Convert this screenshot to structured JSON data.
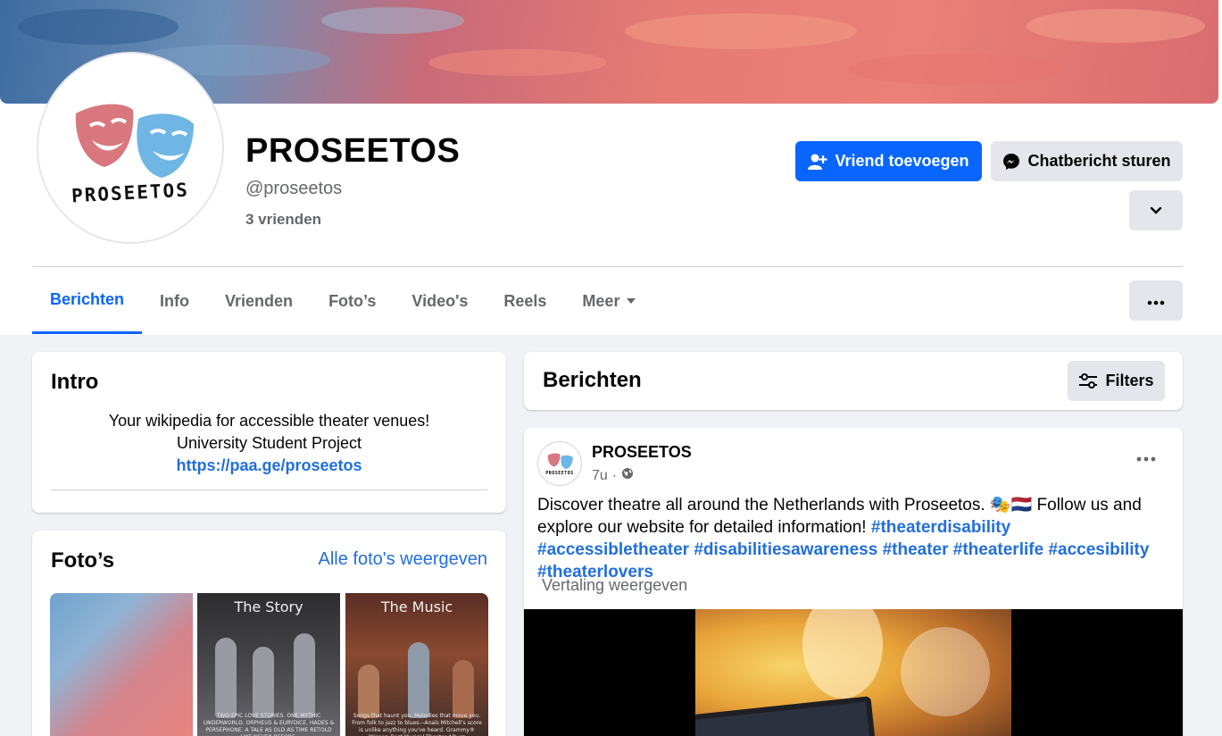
{
  "profile": {
    "name": "PROSEETOS",
    "handle": "@proseetos",
    "friends": "3 vrienden",
    "logo_word": "PROSEETOS"
  },
  "actions": {
    "add_friend": "Vriend toevoegen",
    "message": "Chatbericht sturen"
  },
  "icons": {
    "add_friend": "user-plus-icon",
    "message": "messenger-icon",
    "dropdown": "chevron-down-icon",
    "more": "more-dots-icon",
    "filters": "sliders-icon",
    "audience": "globe-icon"
  },
  "tabs": [
    {
      "label": "Berichten",
      "active": true
    },
    {
      "label": "Info"
    },
    {
      "label": "Vrienden"
    },
    {
      "label": "Foto’s"
    },
    {
      "label": "Video's"
    },
    {
      "label": "Reels"
    },
    {
      "label": "Meer"
    }
  ],
  "intro": {
    "title": "Intro",
    "bio_line1": "Your wikipedia for accessible theater venues!",
    "bio_line2": "University Student Project",
    "link": "https://paa.ge/proseetos"
  },
  "photos": {
    "title": "Foto’s",
    "all_link": "Alle foto's weergeven",
    "items": [
      {
        "title": "",
        "caption": ""
      },
      {
        "title": "The Story",
        "caption": "TWO EPIC LOVE STORIES. ONE MYTHIC UNDERWORLD. ORPHEUS & EURYDICE. HADES & PERSEPHONE. A TALE AS OLD AS TIME RETOLD LIKE NEVER BEFORE."
      },
      {
        "title": "The Music",
        "caption": "Songs that haunt you. Melodies that move you. From folk to jazz to blues—Anaïs Mitchell's score is unlike anything you've heard. Grammy® Winner: Best Musical Theater Album"
      }
    ]
  },
  "posts_section": {
    "title": "Berichten",
    "filters_label": "Filters"
  },
  "post": {
    "author": "PROSEETOS",
    "time": "7u",
    "separator": "·",
    "text_intro": "Discover theatre all around the Netherlands with Proseetos. 🎭🇳🇱 Follow us and explore our website for detailed information! ",
    "hashtags": [
      "#theaterdisability",
      "#accessibletheater",
      "#disabilitiesawareness",
      "#theater",
      "#theaterlife",
      "#accesibility",
      "#theaterlovers"
    ],
    "translate": "Vertaling weergeven"
  },
  "colors": {
    "brand_blue": "#0866ff",
    "link_blue": "#216fdb",
    "mask_pink": "#d9777f",
    "mask_blue": "#6fb6e4"
  }
}
